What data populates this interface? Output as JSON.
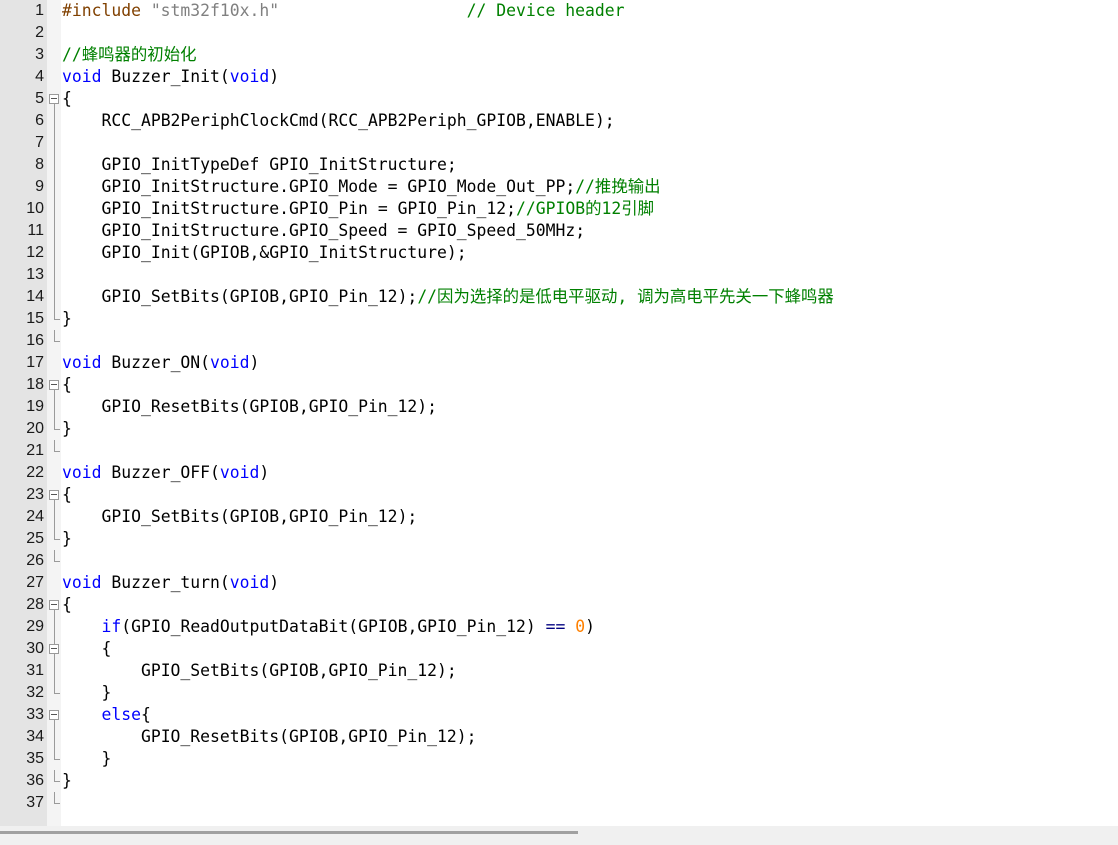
{
  "colors": {
    "keyword": "#0000ff",
    "comment": "#008000",
    "preprocessor": "#804000",
    "string": "#808080",
    "number": "#ff8000",
    "operator": "#000080"
  },
  "lines": [
    {
      "number": "1",
      "fold": "",
      "text": "#include \"stm32f10x.h\"                   // Device header"
    },
    {
      "number": "2",
      "fold": "",
      "text": ""
    },
    {
      "number": "3",
      "fold": "",
      "text": "//蜂鸣器的初始化"
    },
    {
      "number": "4",
      "fold": "",
      "text": "void Buzzer_Init(void)"
    },
    {
      "number": "5",
      "fold": "start",
      "text": "{"
    },
    {
      "number": "6",
      "fold": "mid",
      "text": "    RCC_APB2PeriphClockCmd(RCC_APB2Periph_GPIOB,ENABLE);"
    },
    {
      "number": "7",
      "fold": "mid",
      "text": "    "
    },
    {
      "number": "8",
      "fold": "mid",
      "text": "    GPIO_InitTypeDef GPIO_InitStructure;"
    },
    {
      "number": "9",
      "fold": "mid",
      "text": "    GPIO_InitStructure.GPIO_Mode = GPIO_Mode_Out_PP;//推挽输出"
    },
    {
      "number": "10",
      "fold": "mid",
      "text": "    GPIO_InitStructure.GPIO_Pin = GPIO_Pin_12;//GPIOB的12引脚"
    },
    {
      "number": "11",
      "fold": "mid",
      "text": "    GPIO_InitStructure.GPIO_Speed = GPIO_Speed_50MHz;"
    },
    {
      "number": "12",
      "fold": "mid",
      "text": "    GPIO_Init(GPIOB,&GPIO_InitStructure);"
    },
    {
      "number": "13",
      "fold": "mid",
      "text": "    "
    },
    {
      "number": "14",
      "fold": "mid",
      "text": "    GPIO_SetBits(GPIOB,GPIO_Pin_12);//因为选择的是低电平驱动, 调为高电平先关一下蜂鸣器"
    },
    {
      "number": "15",
      "fold": "end",
      "text": "}"
    },
    {
      "number": "16",
      "fold": "end",
      "text": ""
    },
    {
      "number": "17",
      "fold": "",
      "text": "void Buzzer_ON(void)"
    },
    {
      "number": "18",
      "fold": "start",
      "text": "{"
    },
    {
      "number": "19",
      "fold": "mid",
      "text": "    GPIO_ResetBits(GPIOB,GPIO_Pin_12);"
    },
    {
      "number": "20",
      "fold": "end",
      "text": "}"
    },
    {
      "number": "21",
      "fold": "end",
      "text": ""
    },
    {
      "number": "22",
      "fold": "",
      "text": "void Buzzer_OFF(void)"
    },
    {
      "number": "23",
      "fold": "start",
      "text": "{"
    },
    {
      "number": "24",
      "fold": "mid",
      "text": "    GPIO_SetBits(GPIOB,GPIO_Pin_12);"
    },
    {
      "number": "25",
      "fold": "end",
      "text": "}"
    },
    {
      "number": "26",
      "fold": "end",
      "text": ""
    },
    {
      "number": "27",
      "fold": "",
      "text": "void Buzzer_turn(void)"
    },
    {
      "number": "28",
      "fold": "start",
      "text": "{"
    },
    {
      "number": "29",
      "fold": "mid",
      "text": "    if(GPIO_ReadOutputDataBit(GPIOB,GPIO_Pin_12) == 0)"
    },
    {
      "number": "30",
      "fold": "start",
      "text": "    {"
    },
    {
      "number": "31",
      "fold": "mid",
      "text": "        GPIO_SetBits(GPIOB,GPIO_Pin_12);"
    },
    {
      "number": "32",
      "fold": "end",
      "text": "    }"
    },
    {
      "number": "33",
      "fold": "start",
      "text": "    else{"
    },
    {
      "number": "34",
      "fold": "mid",
      "text": "        GPIO_ResetBits(GPIOB,GPIO_Pin_12);"
    },
    {
      "number": "35",
      "fold": "end",
      "text": "    }"
    },
    {
      "number": "36",
      "fold": "end",
      "text": "}"
    },
    {
      "number": "37",
      "fold": "end",
      "text": ""
    }
  ]
}
